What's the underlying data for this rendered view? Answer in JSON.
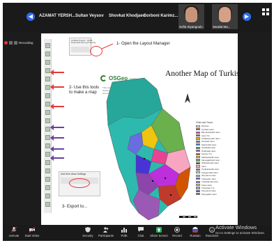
{
  "top_bar": {
    "participants": [
      "AZAMAT YERSH...",
      "Sultan Veysov",
      "Shovkat Khodjaev",
      "Sorboni Karimz..."
    ],
    "video_tiles": [
      "Sofia Siyangoulo",
      "Saodat Ma..."
    ]
  },
  "recording": {
    "label": "Recording"
  },
  "slide": {
    "annotations": {
      "step1": "1- Open the Layout Manager",
      "step2": "2- Use this tools to make a map",
      "step3": "3- Export to..."
    },
    "qgis_window": {
      "title": "Untitled Project - QGIS",
      "menu": "Project  Edit  View  Layer  Settings"
    },
    "export_window": {
      "menu": "Add Item   Atlas   Settings"
    },
    "osgeo": {
      "name": "OSGeo",
      "tagline": "Project",
      "subtitle": "This map was built using QGIS. Atlases, drawings, diagrams, reference, and other sources of information"
    },
    "map_title": "Another Map of Turkistan",
    "legend": {
      "header": "Cities and Towns",
      "items": [
        {
          "label": "Districts",
          "color": "#ffffff"
        },
        {
          "label": "Arysskii raion",
          "color": "#c0392b"
        },
        {
          "label": "Bai-Abyiskiskii raion",
          "color": "#e84393"
        },
        {
          "label": "Arysi T.A.",
          "color": "#8e44ad"
        },
        {
          "label": "Ordabasynskii raion",
          "color": "#f39c12"
        },
        {
          "label": "Otrarskii raion",
          "color": "#27ae60"
        },
        {
          "label": "Sairamskii raion",
          "color": "#2e86de"
        },
        {
          "label": "Sozakskii raion",
          "color": "#16a085"
        },
        {
          "label": "Tolebiiskii raion",
          "color": "#9b59b6"
        },
        {
          "label": "Kentau T.A.",
          "color": "#d35400"
        },
        {
          "label": "Mahtaaralskii raion",
          "color": "#f1c40f"
        },
        {
          "label": "Saryagashskii raion",
          "color": "#6ab04c"
        },
        {
          "label": "Shardarinskii raion",
          "color": "#30336b"
        },
        {
          "label": "raion",
          "color": "#f8a5c2"
        },
        {
          "label": "Tyulkubasskii raion",
          "color": "#eb4d4b"
        },
        {
          "label": "Kazygurtskii raion",
          "color": "#c7ecee"
        },
        {
          "label": "Shymkent raion",
          "color": "#7ed6df"
        },
        {
          "label": "Turkestan raion",
          "color": "#686de0"
        },
        {
          "label": "Turkistanskii raion",
          "color": "#e056fd"
        },
        {
          "label": "Keles raion",
          "color": "#badc58"
        },
        {
          "label": "Turkestan T.A.",
          "color": "#95afc0"
        },
        {
          "label": "Shymkent raion",
          "color": "#4834d4"
        },
        {
          "label": "Saryagash raion",
          "color": "#be2edd"
        }
      ]
    }
  },
  "bottom_bar": {
    "items": [
      {
        "label": "Unmute",
        "icon": "mic-icon"
      },
      {
        "label": "Start Video",
        "icon": "camera-icon"
      },
      {
        "label": "Security",
        "icon": "shield-icon"
      },
      {
        "label": "Participants",
        "icon": "people-icon"
      },
      {
        "label": "Polls",
        "icon": "poll-icon"
      },
      {
        "label": "Chat",
        "icon": "chat-icon"
      },
      {
        "label": "Share Screen",
        "icon": "share-icon"
      },
      {
        "label": "Record",
        "icon": "record-icon"
      },
      {
        "label": "Russian",
        "icon": "globe-icon"
      },
      {
        "label": "Reactions",
        "icon": "smile-icon"
      }
    ]
  },
  "watermark": {
    "line1": "Activate Windows",
    "line2": "Go to Settings to activate Windows."
  }
}
